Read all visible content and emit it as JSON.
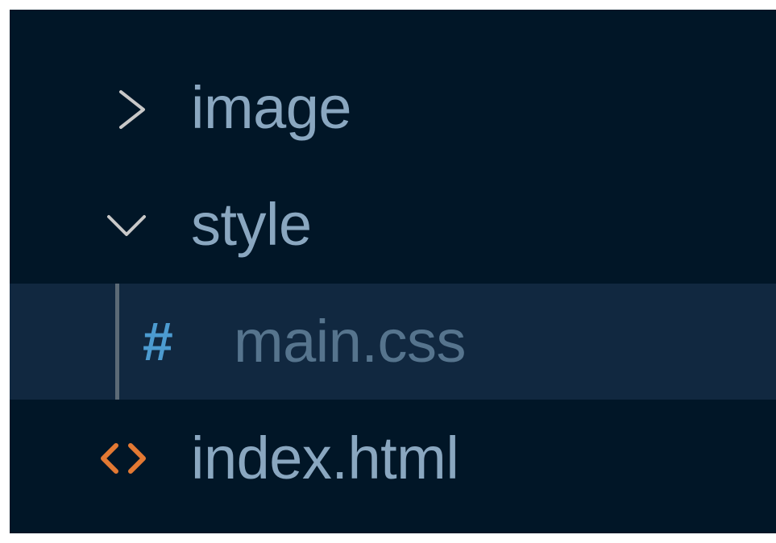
{
  "explorer": {
    "items": [
      {
        "label": "image",
        "type": "folder",
        "expanded": false,
        "icon": "chevron-right-icon"
      },
      {
        "label": "style",
        "type": "folder",
        "expanded": true,
        "icon": "chevron-down-icon"
      },
      {
        "label": "main.css",
        "type": "file",
        "selected": true,
        "icon": "css-hash-icon",
        "icon_glyph": "#"
      },
      {
        "label": "index.html",
        "type": "file",
        "icon": "html-brackets-icon"
      }
    ]
  },
  "colors": {
    "background": "#011627",
    "selected_row": "#112840",
    "label": "#8aa7c0",
    "selected_label": "#56748d",
    "chevron": "#c8c8c8",
    "css_icon": "#4c9bd0",
    "html_icon": "#e37933",
    "indent_guide": "#5c6a76"
  }
}
